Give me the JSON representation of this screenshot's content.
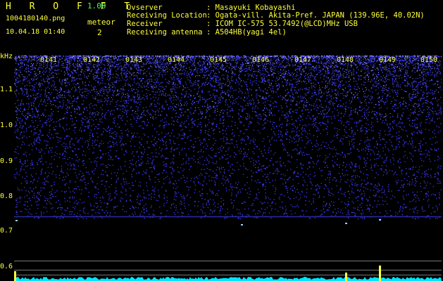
{
  "header": {
    "app_title": "H R O F F T",
    "version": "1.00",
    "filename": "1004180140.png",
    "datetime": "10.04.18 01:40",
    "meteor_label": "meteor",
    "meteor_count": "2"
  },
  "info": [
    {
      "label": "Ovserver",
      "value": ": Masayuki Kobayashi"
    },
    {
      "label": "Receiving Location",
      "value": ": Ogata-vill. Akita-Pref. JAPAN (139.96E, 40.02N)"
    },
    {
      "label": "Receiver",
      "value": ": ICOM IC-575 53.7492(@LCD)MHz USB"
    },
    {
      "label": "Receiving antenna",
      "value": ": A504HB(yagi 4el)"
    }
  ],
  "spectrogram": {
    "y_unit": "kHz",
    "y_ticks": [
      "1.1",
      "1.0",
      "0.9",
      "0.8",
      "0.7",
      "0.6"
    ],
    "x_ticks": [
      "0141",
      "0142",
      "0143",
      "0144",
      "0145",
      "0146",
      "0147",
      "0148",
      "0149",
      "0150"
    ],
    "colors": {
      "noise": "#3c3cff",
      "signal_line": "#2a2aa8",
      "bottom_trace": "#00e5ff",
      "meteor": "#ffff3c"
    }
  }
}
